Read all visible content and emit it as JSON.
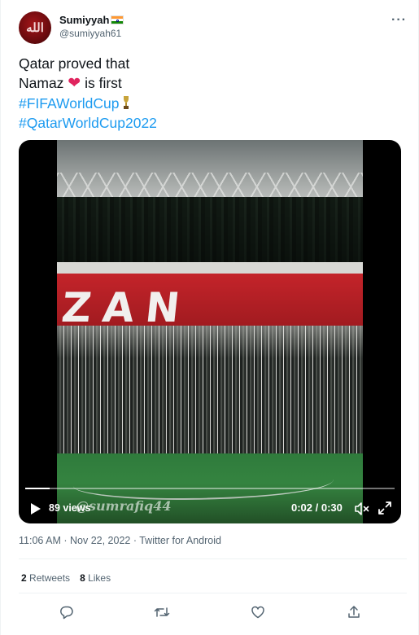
{
  "author": {
    "display_name": "Sumiyyah",
    "handle": "@sumiyyah61",
    "avatar_text": "الله"
  },
  "menu_icon": "more-dots-icon",
  "tweet": {
    "line1": "Qatar proved that",
    "line2_prefix": "Namaz ",
    "line2_emoji": "❤️",
    "line2_suffix": " is first",
    "hashtag1": "#FIFAWorldCup",
    "hashtag2": "#QatarWorldCup2022"
  },
  "video": {
    "banner_text": "ZAN",
    "views": "89 views",
    "watermark": "@sumrafiq44",
    "time": "0:02 / 0:30",
    "progress": 0.067
  },
  "meta": {
    "line": "11:06 AM · Nov 22, 2022 · Twitter for Android"
  },
  "stats": {
    "retweets_count": "2",
    "retweets_label": "Retweets",
    "likes_count": "8",
    "likes_label": "Likes"
  },
  "actions": [
    "reply-icon",
    "retweet-icon",
    "like-icon",
    "share-icon"
  ],
  "colors": {
    "link": "#1d9bf0",
    "secondary_text": "#536471",
    "heart": "#e0245e"
  }
}
